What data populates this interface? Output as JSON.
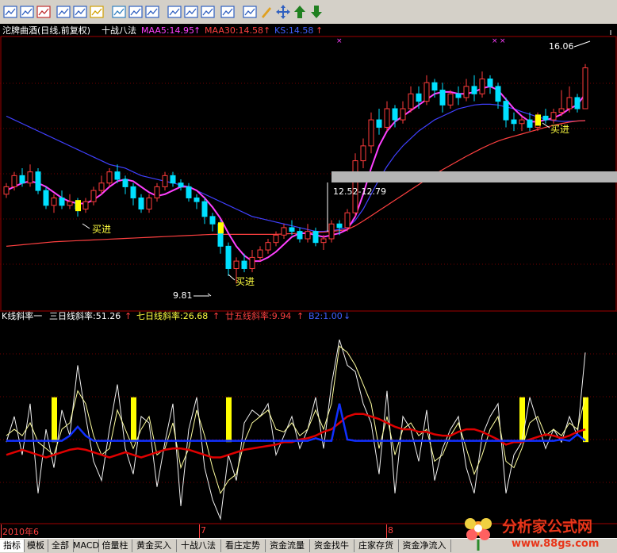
{
  "main_header": {
    "title": "沱牌曲酒(日线,前复权)",
    "method": "十战八法",
    "maa5": "MAA5:14.95",
    "maa30": "MAA30:14.58",
    "ks": "KS:14.58"
  },
  "main_annotations": {
    "high_price": "16.06",
    "low_price": "9.81",
    "range_label": "12.52-12.79",
    "buy_label": "买进"
  },
  "sub_header": {
    "name": "K线斜率一",
    "s3": "三日线斜率:51.26",
    "s7": "七日线斜率:26.68",
    "s25": "廿五线斜率:9.94",
    "b2": "B2:1.00"
  },
  "date_axis": {
    "m1": "2010年6",
    "m2": "7",
    "m3": "8"
  },
  "bottom_tabs": [
    "指标",
    "模板",
    "全部",
    "MACD",
    "倍量柱",
    "黄金买入",
    "十战八法",
    "看庄定势",
    "资金流量",
    "资金找牛",
    "庄家存货",
    "资金净流入"
  ],
  "watermark": {
    "text": "分析家公式网",
    "url": "www.88gs.com"
  },
  "colors": {
    "up": "#ff3c3c",
    "down": "#00e0ff",
    "maa5": "#ff40ff",
    "maa30": "#ff4040",
    "ks": "#4040ff",
    "flag": "#ffff00",
    "axis": "#a00000"
  },
  "toolbar_icons": [
    "grid-icon",
    "table-icon",
    "line-chart-icon",
    "bar-chart-icon",
    "candle-icon",
    "dollar-icon",
    "people-icon",
    "function-icon",
    "split-icon",
    "eye-icon",
    "rsi-icon",
    "indicator-icon",
    "zoom-icon",
    "draw-icon",
    "pen-icon",
    "move-icon",
    "arrow-up-icon",
    "arrow-down-icon"
  ],
  "price_series": {
    "ylim": [
      9.5,
      16.8
    ],
    "candles": [
      [
        12.6,
        12.8,
        12.9,
        12.5
      ],
      [
        12.8,
        13.1,
        13.2,
        12.7
      ],
      [
        13.1,
        12.9,
        13.3,
        12.8
      ],
      [
        12.9,
        13.2,
        13.4,
        12.8
      ],
      [
        13.2,
        12.7,
        13.3,
        12.6
      ],
      [
        12.7,
        12.3,
        12.8,
        12.2
      ],
      [
        12.3,
        12.5,
        12.6,
        12.1
      ],
      [
        12.5,
        12.3,
        12.7,
        12.2
      ],
      [
        12.3,
        12.4,
        12.6,
        12.2
      ],
      [
        12.4,
        12.2,
        12.5,
        12.0
      ],
      [
        12.2,
        12.4,
        12.5,
        12.1
      ],
      [
        12.4,
        12.7,
        12.8,
        12.3
      ],
      [
        12.7,
        12.9,
        13.1,
        12.6
      ],
      [
        12.9,
        13.2,
        13.3,
        12.8
      ],
      [
        13.2,
        13.0,
        13.4,
        12.9
      ],
      [
        13.0,
        12.8,
        13.1,
        12.6
      ],
      [
        12.8,
        12.5,
        12.9,
        12.3
      ],
      [
        12.5,
        12.2,
        12.6,
        12.1
      ],
      [
        12.2,
        12.5,
        12.6,
        12.1
      ],
      [
        12.5,
        12.8,
        12.9,
        12.4
      ],
      [
        12.8,
        13.1,
        13.2,
        12.7
      ],
      [
        13.1,
        12.9,
        13.2,
        12.8
      ],
      [
        12.9,
        12.8,
        13.0,
        12.7
      ],
      [
        12.8,
        12.5,
        12.9,
        12.4
      ],
      [
        12.5,
        12.4,
        12.6,
        12.2
      ],
      [
        12.4,
        12.0,
        12.5,
        11.8
      ],
      [
        12.0,
        11.8,
        12.1,
        11.6
      ],
      [
        11.8,
        11.2,
        11.9,
        11.0
      ],
      [
        11.2,
        10.6,
        11.3,
        10.4
      ],
      [
        10.6,
        10.8,
        10.9,
        10.2
      ],
      [
        10.8,
        10.6,
        11.0,
        10.5
      ],
      [
        10.6,
        10.9,
        11.1,
        10.5
      ],
      [
        10.9,
        11.1,
        11.2,
        10.8
      ],
      [
        11.1,
        11.3,
        11.4,
        11.0
      ],
      [
        11.3,
        11.5,
        11.6,
        11.2
      ],
      [
        11.5,
        11.7,
        11.8,
        11.4
      ],
      [
        11.7,
        11.6,
        11.9,
        11.5
      ],
      [
        11.6,
        11.4,
        11.7,
        11.3
      ],
      [
        11.4,
        11.6,
        11.8,
        11.3
      ],
      [
        11.6,
        11.3,
        11.7,
        11.2
      ],
      [
        11.3,
        11.4,
        11.5,
        11.1
      ],
      [
        11.4,
        11.8,
        11.9,
        11.3
      ],
      [
        11.8,
        11.7,
        11.9,
        11.5
      ],
      [
        11.7,
        12.1,
        12.2,
        11.6
      ],
      [
        12.1,
        13.5,
        13.7,
        12.0
      ],
      [
        13.5,
        13.9,
        14.1,
        13.3
      ],
      [
        13.9,
        14.6,
        14.8,
        13.7
      ],
      [
        14.6,
        14.4,
        14.9,
        14.2
      ],
      [
        14.4,
        14.9,
        15.1,
        14.3
      ],
      [
        14.9,
        14.6,
        15.0,
        14.4
      ],
      [
        14.6,
        14.9,
        15.1,
        14.5
      ],
      [
        14.9,
        15.3,
        15.5,
        14.8
      ],
      [
        15.3,
        15.1,
        15.5,
        14.9
      ],
      [
        15.1,
        15.6,
        15.8,
        15.0
      ],
      [
        15.6,
        15.4,
        15.7,
        15.2
      ],
      [
        15.4,
        15.0,
        15.6,
        14.8
      ],
      [
        15.0,
        15.3,
        15.4,
        14.9
      ],
      [
        15.3,
        15.2,
        15.5,
        15.0
      ],
      [
        15.2,
        15.5,
        15.7,
        15.1
      ],
      [
        15.5,
        15.3,
        15.8,
        15.1
      ],
      [
        15.3,
        15.7,
        15.9,
        15.2
      ],
      [
        15.7,
        15.5,
        15.8,
        15.3
      ],
      [
        15.5,
        15.1,
        15.6,
        14.9
      ],
      [
        15.1,
        14.6,
        15.2,
        14.4
      ],
      [
        14.6,
        14.5,
        14.8,
        14.3
      ],
      [
        14.5,
        14.6,
        14.7,
        14.3
      ],
      [
        14.6,
        14.4,
        14.8,
        14.3
      ],
      [
        14.4,
        14.7,
        14.8,
        14.3
      ],
      [
        14.7,
        14.6,
        14.9,
        14.5
      ],
      [
        14.6,
        14.8,
        14.9,
        14.5
      ],
      [
        14.8,
        14.9,
        15.4,
        14.7
      ],
      [
        14.9,
        15.2,
        15.5,
        14.8
      ],
      [
        15.2,
        14.9,
        15.3,
        14.8
      ],
      [
        14.9,
        16.0,
        16.1,
        14.9
      ]
    ],
    "maa5": [
      12.7,
      12.8,
      12.9,
      12.95,
      12.9,
      12.8,
      12.65,
      12.5,
      12.4,
      12.35,
      12.35,
      12.45,
      12.6,
      12.8,
      12.95,
      13.0,
      12.95,
      12.8,
      12.65,
      12.55,
      12.6,
      12.7,
      12.8,
      12.8,
      12.7,
      12.5,
      12.25,
      11.95,
      11.55,
      11.2,
      10.95,
      10.8,
      10.8,
      10.9,
      11.05,
      11.25,
      11.45,
      11.55,
      11.55,
      11.5,
      11.45,
      11.5,
      11.55,
      11.65,
      12.0,
      12.6,
      13.3,
      13.9,
      14.3,
      14.55,
      14.7,
      14.85,
      15.0,
      15.15,
      15.3,
      15.35,
      15.35,
      15.3,
      15.3,
      15.35,
      15.45,
      15.5,
      15.4,
      15.15,
      14.9,
      14.7,
      14.55,
      14.55,
      14.6,
      14.65,
      14.75,
      14.9,
      15.0,
      15.3
    ],
    "maa30": [
      11.2,
      11.22,
      11.24,
      11.26,
      11.28,
      11.3,
      11.32,
      11.33,
      11.34,
      11.35,
      11.36,
      11.37,
      11.38,
      11.39,
      11.4,
      11.41,
      11.42,
      11.43,
      11.44,
      11.45,
      11.46,
      11.47,
      11.48,
      11.49,
      11.5,
      11.51,
      11.52,
      11.52,
      11.52,
      11.52,
      11.52,
      11.52,
      11.52,
      11.52,
      11.52,
      11.53,
      11.54,
      11.55,
      11.56,
      11.57,
      11.58,
      11.6,
      11.62,
      11.65,
      11.75,
      11.88,
      12.02,
      12.16,
      12.3,
      12.44,
      12.58,
      12.72,
      12.86,
      13.0,
      13.13,
      13.26,
      13.38,
      13.5,
      13.62,
      13.73,
      13.84,
      13.94,
      14.03,
      14.1,
      14.16,
      14.22,
      14.28,
      14.34,
      14.4,
      14.45,
      14.5,
      14.54,
      14.57,
      14.58
    ],
    "ks": [
      14.7,
      14.6,
      14.5,
      14.4,
      14.3,
      14.2,
      14.1,
      14.0,
      13.9,
      13.8,
      13.7,
      13.6,
      13.5,
      13.4,
      13.35,
      13.3,
      13.2,
      13.1,
      13.05,
      13.0,
      12.95,
      12.9,
      12.85,
      12.8,
      12.7,
      12.6,
      12.5,
      12.4,
      12.3,
      12.2,
      12.1,
      12.0,
      11.95,
      11.9,
      11.85,
      11.8,
      11.75,
      11.7,
      11.65,
      11.6,
      11.6,
      11.62,
      11.65,
      11.7,
      11.9,
      12.2,
      12.6,
      13.0,
      13.35,
      13.65,
      13.9,
      14.1,
      14.3,
      14.45,
      14.6,
      14.7,
      14.8,
      14.9,
      14.95,
      15.0,
      15.02,
      15.02,
      15.0,
      14.95,
      14.9,
      14.82,
      14.75,
      14.68,
      14.62,
      14.58,
      14.56,
      14.56,
      14.57,
      14.58
    ],
    "buy_points": [
      12,
      37,
      89,
      97
    ],
    "flag_points": [
      13,
      37,
      89,
      97
    ]
  },
  "slope_series": {
    "ylim": [
      -60,
      90
    ],
    "s3": [
      0,
      20,
      -10,
      30,
      -40,
      10,
      -20,
      25,
      5,
      60,
      20,
      -15,
      -30,
      10,
      45,
      -5,
      -25,
      20,
      15,
      -35,
      0,
      30,
      -50,
      10,
      35,
      -20,
      -45,
      -60,
      -10,
      -30,
      15,
      25,
      20,
      30,
      -10,
      5,
      20,
      -5,
      10,
      35,
      -5,
      45,
      80,
      60,
      55,
      30,
      15,
      -25,
      40,
      -40,
      20,
      10,
      -15,
      25,
      -30,
      -5,
      10,
      20,
      -20,
      -40,
      5,
      20,
      30,
      -40,
      -10,
      0,
      35,
      15,
      -5,
      10,
      0,
      20,
      5,
      70
    ],
    "s7": [
      5,
      10,
      5,
      15,
      0,
      -5,
      -10,
      10,
      15,
      40,
      30,
      5,
      -10,
      -5,
      25,
      10,
      -5,
      10,
      20,
      -10,
      -5,
      15,
      -20,
      -5,
      25,
      5,
      -20,
      -40,
      -30,
      -25,
      0,
      15,
      20,
      25,
      10,
      8,
      15,
      5,
      10,
      25,
      10,
      30,
      75,
      70,
      60,
      45,
      30,
      -5,
      20,
      -10,
      10,
      15,
      5,
      10,
      -15,
      -10,
      5,
      15,
      -5,
      -25,
      -10,
      10,
      20,
      -15,
      -20,
      -5,
      15,
      20,
      5,
      10,
      5,
      15,
      10,
      35
    ],
    "s25": [
      -10,
      -8,
      -6,
      -8,
      -10,
      -12,
      -10,
      -8,
      -6,
      -5,
      -6,
      -8,
      -10,
      -12,
      -10,
      -8,
      -10,
      -12,
      -10,
      -8,
      -6,
      -5,
      -5,
      -6,
      -8,
      -10,
      -12,
      -12,
      -10,
      -8,
      -6,
      -5,
      -4,
      -3,
      -2,
      0,
      0,
      2,
      3,
      5,
      8,
      10,
      15,
      20,
      22,
      22,
      20,
      18,
      15,
      12,
      10,
      10,
      8,
      8,
      6,
      5,
      5,
      8,
      10,
      10,
      8,
      5,
      2,
      -2,
      0,
      0,
      2,
      4,
      6,
      5,
      3,
      5,
      8,
      9.94
    ],
    "b2": [
      1,
      1,
      1,
      1,
      1,
      1,
      1,
      1,
      5,
      12,
      5,
      1,
      1,
      1,
      1,
      1,
      1,
      1,
      1,
      1,
      1,
      1,
      1,
      1,
      1,
      1,
      1,
      1,
      1,
      1,
      1,
      1,
      1,
      1,
      1,
      1,
      1,
      1,
      1,
      3,
      1,
      1,
      30,
      2,
      1,
      1,
      1,
      1,
      1,
      1,
      1,
      1,
      1,
      1,
      1,
      1,
      1,
      1,
      1,
      1,
      1,
      1,
      1,
      1,
      1,
      1,
      1,
      1,
      1,
      1,
      2,
      1,
      6,
      1
    ],
    "flags": [
      8,
      19,
      37,
      89,
      97
    ]
  }
}
